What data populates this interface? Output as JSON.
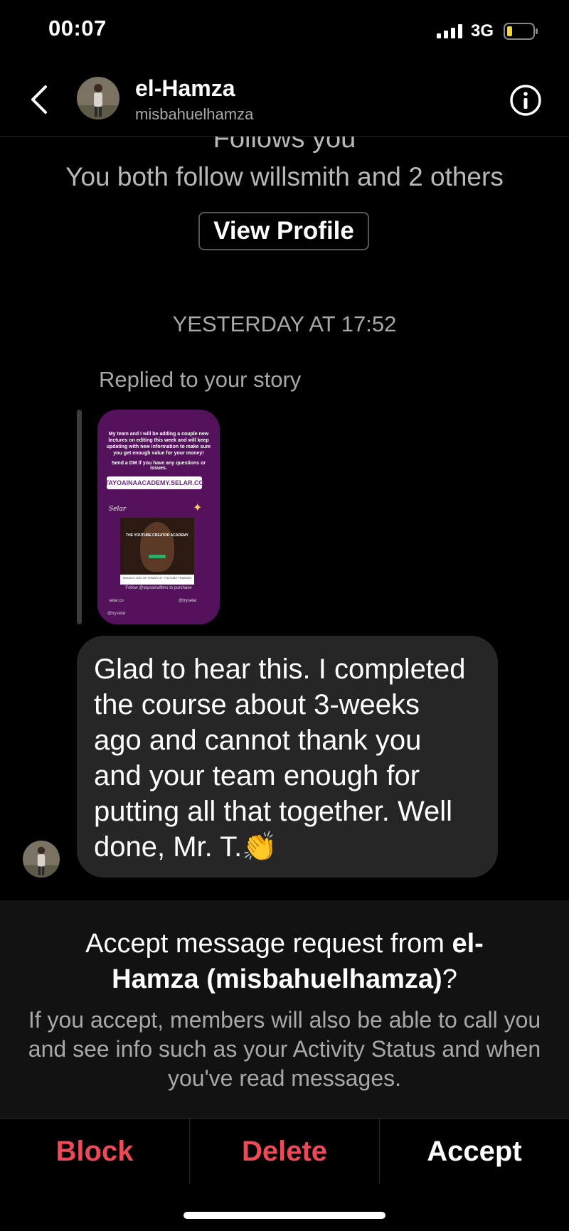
{
  "status_bar": {
    "time": "00:07",
    "network": "3G"
  },
  "header": {
    "name": "el-Hamza",
    "username": "misbahuelhamza"
  },
  "profile_summary": {
    "follows_you": "Follows you",
    "mutuals": "You both follow willsmith and 2 others",
    "view_profile_label": "View Profile"
  },
  "thread": {
    "timestamp": "YESTERDAY AT 17:52",
    "reply_context": "Replied to your story",
    "story": {
      "top_text": "My team and I will be adding a couple new lectures on editing this week and will keep updating with new information to make sure you get enough value for your money!",
      "dm_text": "Send a DM if you have any questions or issues.",
      "link": "TAYOAINAACADEMY.SELAR.CO",
      "brand": "Selar",
      "card_title": "THE YOUTUBE CREATOR ACADEMY",
      "card_caption": "SEARCH 100S OF HOURS OF YOUTUBE TRAINING",
      "follow_text": "Follow @tayoainafilms to purchase",
      "site": "selar.co",
      "handle": "@tryselar",
      "handle2": "@tryselar"
    },
    "message": {
      "line1": "Glad to hear this. I completed",
      "line2": "the course about 3-weeks",
      "line3": "ago and cannot thank you",
      "line4": "and your team enough for",
      "line5": "putting all that together. Well",
      "line6": "done, Mr. T.👏"
    }
  },
  "request": {
    "title_prefix": "Accept message request from ",
    "title_name_1": "el-",
    "title_name_2": "Hamza (misbahuelhamza)",
    "title_suffix": "?",
    "body": "If you accept, members will also be able to call you and see info such as your Activity Status and when you've read messages."
  },
  "actions": {
    "block": "Block",
    "delete": "Delete",
    "accept": "Accept"
  },
  "colors": {
    "background": "#000000",
    "bubble": "#262626",
    "destructive": "#ed4956",
    "secondary_text": "#a8a8a8"
  },
  "icons": [
    "back-chevron-icon",
    "info-icon",
    "signal-icon",
    "battery-icon",
    "clap-emoji"
  ]
}
